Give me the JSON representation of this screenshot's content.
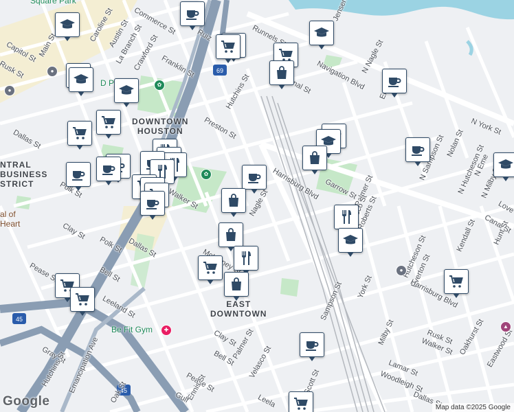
{
  "map": {
    "attribution": "Map data ©2025 Google",
    "logo": "Google",
    "colors": {
      "land": "#eef0f3",
      "water": "#9bd3e3",
      "park": "#c6e8c8",
      "highway": "#8a9db3",
      "road": "#ffffff",
      "rail": "#b4b8be",
      "district": "#f6ecc4"
    },
    "districts": [
      {
        "id": "downtown",
        "lines": [
          "DOWNTOWN",
          "HOUSTON"
        ]
      },
      {
        "id": "east-downtown",
        "lines": [
          "EAST",
          "DOWNTOWN"
        ]
      },
      {
        "id": "central-district",
        "lines": [
          "NTRAL",
          "BUSINESS",
          "STRICT"
        ]
      }
    ],
    "pois": [
      {
        "id": "dpark",
        "label": "D  Park"
      },
      {
        "id": "befit",
        "label": "Be Fit Gym"
      },
      {
        "id": "sacred",
        "label": "al of\nHeart"
      },
      {
        "id": "square",
        "label": "Square Park"
      }
    ],
    "streets": [
      "Runnels St",
      "Navigation Blvd",
      "Canal St",
      "N Nagle St",
      "Harrisburg Blvd",
      "Garrow St",
      "Preston St",
      "Hutchins St",
      "Crawford St",
      "Franklin St",
      "La Branch St",
      "Austin St",
      "Caroline St",
      "Main St",
      "Capitol St",
      "Rusk St",
      "Dallas St",
      "Polk St",
      "Clay St",
      "Walker St",
      "Nagle St",
      "McKinney St",
      "Pease St",
      "Bell St",
      "Leeland St",
      "Gray St",
      "Hutchins St",
      "Clay St",
      "Bell St",
      "Palmer St",
      "Velasco St",
      "Pease St",
      "Ennis St",
      "Oak St",
      "Emancipation Ave",
      "Scott St",
      "Sampson St",
      "York St",
      "Milby St",
      "Hutcheson St",
      "Everton St",
      "Roberts St",
      "Palmer St",
      "Velasco St",
      "N Sampson St",
      "Nolan St",
      "N Hutcheson St",
      "N Milby St",
      "N York St",
      "Canal St",
      "Harrisburg Blvd",
      "Rusk St",
      "Walker St",
      "Lamar St",
      "Woodleigh St",
      "Dallas St",
      "Oakhurst St",
      "Eastwood St",
      "Kendall St",
      "Hunt St",
      "Love St",
      "N Eme",
      "Ruiz",
      "Commerce St",
      "Polk St",
      "Leela",
      "Gulf",
      "Jensen Dr",
      "Ernst",
      "Dallas St"
    ],
    "shields": [
      "69",
      "45",
      "45"
    ]
  }
}
